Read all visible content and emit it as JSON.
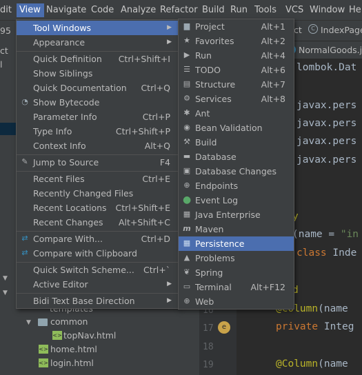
{
  "menubar": {
    "items": [
      {
        "label": "dit"
      },
      {
        "label": "View",
        "active": true
      },
      {
        "label": "Navigate"
      },
      {
        "label": "Code"
      },
      {
        "label": "Analyze"
      },
      {
        "label": "Refactor"
      },
      {
        "label": "Build"
      },
      {
        "label": "Run"
      },
      {
        "label": "Tools"
      },
      {
        "label": "VCS"
      },
      {
        "label": "Window"
      },
      {
        "label": "He"
      }
    ]
  },
  "toolbar": {
    "prefix": "95",
    "crumb1": "ct",
    "crumb2": "IndexPage"
  },
  "editor_tab": {
    "label": "NormalGoods.ja"
  },
  "left_panel": {
    "row1": "ct",
    "row2": "l"
  },
  "code_lines": {
    "l1": "lombok.Dat",
    "l2": "javax.pers",
    "l3": "javax.pers",
    "l4": "javax.pers",
    "l5": "javax.pers",
    "l6a": "(name = ",
    "l6b": "\"in",
    "l7a": "class ",
    "l7b": "Inde",
    "l8": "d",
    "l9a": "@Column",
    "l9b": "(name",
    "l10a": "private ",
    "l10b": "Integ",
    "l11a": "@Column",
    "l11b": "(name"
  },
  "line_numbers": {
    "n16": "16",
    "n17": "17",
    "n18": "18",
    "n19": "19"
  },
  "tree": {
    "templates": "templates",
    "common": "common",
    "topnav": "topNav.html",
    "home": "home.html",
    "login": "login.html"
  },
  "view_menu": {
    "items": [
      {
        "label": "Tool Windows",
        "underline": "T",
        "submenu": true,
        "selected": true
      },
      {
        "label": "Appearance",
        "submenu": true
      },
      {
        "label": "Quick Definition",
        "shortcut": "Ctrl+Shift+I"
      },
      {
        "label": "Show Siblings"
      },
      {
        "label": "Quick Documentation",
        "shortcut": "Ctrl+Q"
      },
      {
        "label": "Show Bytecode",
        "icon": "bytecode-icon"
      },
      {
        "label": "Parameter Info",
        "shortcut": "Ctrl+P"
      },
      {
        "label": "Type Info",
        "shortcut": "Ctrl+Shift+P"
      },
      {
        "label": "Context Info",
        "shortcut": "Alt+Q"
      },
      {
        "label": "Jump to Source",
        "shortcut": "F4",
        "icon": "jump-icon"
      },
      {
        "label": "Recent Files",
        "shortcut": "Ctrl+E"
      },
      {
        "label": "Recently Changed Files"
      },
      {
        "label": "Recent Locations",
        "shortcut": "Ctrl+Shift+E"
      },
      {
        "label": "Recent Changes",
        "shortcut": "Alt+Shift+C"
      },
      {
        "label": "Compare With...",
        "shortcut": "Ctrl+D",
        "icon": "compare-icon"
      },
      {
        "label": "Compare with Clipboard",
        "icon": "compare-clipboard-icon"
      },
      {
        "label": "Quick Switch Scheme...",
        "shortcut": "Ctrl+`"
      },
      {
        "label": "Active Editor",
        "submenu": true
      },
      {
        "label": "Bidi Text Base Direction",
        "submenu": true
      }
    ]
  },
  "tool_windows_menu": {
    "items": [
      {
        "label": "Project",
        "shortcut": "Alt+1"
      },
      {
        "label": "Favorites",
        "shortcut": "Alt+2"
      },
      {
        "label": "Run",
        "shortcut": "Alt+4"
      },
      {
        "label": "TODO",
        "shortcut": "Alt+6"
      },
      {
        "label": "Structure",
        "shortcut": "Alt+7"
      },
      {
        "label": "Services",
        "shortcut": "Alt+8"
      },
      {
        "label": "Ant"
      },
      {
        "label": "Bean Validation"
      },
      {
        "label": "Build"
      },
      {
        "label": "Database"
      },
      {
        "label": "Database Changes"
      },
      {
        "label": "Endpoints"
      },
      {
        "label": "Event Log"
      },
      {
        "label": "Java Enterprise"
      },
      {
        "label": "Maven"
      },
      {
        "label": "Persistence",
        "selected": true
      },
      {
        "label": "Problems"
      },
      {
        "label": "Spring"
      },
      {
        "label": "Terminal",
        "shortcut": "Alt+F12"
      },
      {
        "label": "Web"
      }
    ]
  },
  "colors": {
    "selection": "#4b6eaf",
    "menu_bg": "#3c3f41",
    "editor_bg": "#2b2b2b"
  }
}
